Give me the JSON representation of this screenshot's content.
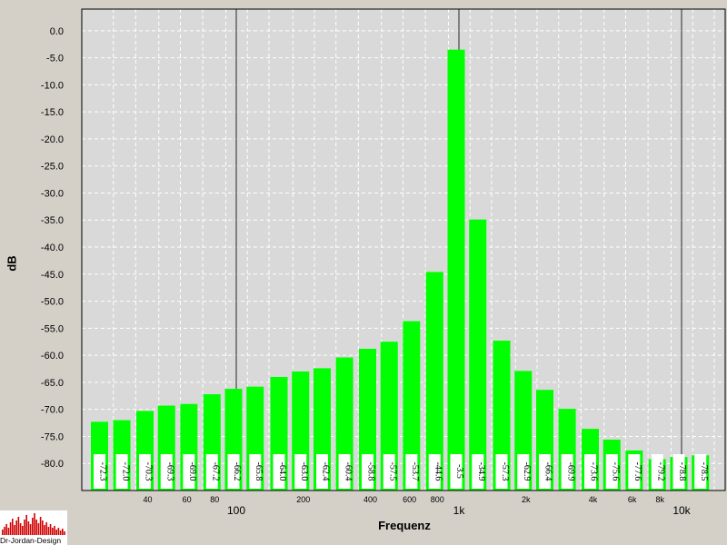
{
  "chart_data": {
    "type": "bar",
    "title": "",
    "xlabel": "Frequenz",
    "ylabel": "dB",
    "ylim": [
      -85,
      4
    ],
    "y_ticks": [
      0,
      -5,
      -10,
      -15,
      -20,
      -25,
      -30,
      -35,
      -40,
      -45,
      -50,
      -55,
      -60,
      -65,
      -70,
      -75,
      -80
    ],
    "x_scale": "log",
    "x_major_ticks": [
      {
        "value": 100,
        "label": "100"
      },
      {
        "value": 1000,
        "label": "1k"
      },
      {
        "value": 10000,
        "label": "10k"
      }
    ],
    "x_minor_ticks": [
      {
        "value": 40,
        "label": "40"
      },
      {
        "value": 60,
        "label": "60"
      },
      {
        "value": 80,
        "label": "80"
      },
      {
        "value": 200,
        "label": "200"
      },
      {
        "value": 400,
        "label": "400"
      },
      {
        "value": 600,
        "label": "600"
      },
      {
        "value": 800,
        "label": "800"
      },
      {
        "value": 2000,
        "label": "2k"
      },
      {
        "value": 4000,
        "label": "4k"
      },
      {
        "value": 6000,
        "label": "6k"
      },
      {
        "value": 8000,
        "label": "8k"
      }
    ],
    "x": [
      25,
      31.5,
      40,
      50,
      63,
      80,
      100,
      125,
      160,
      200,
      250,
      315,
      400,
      500,
      630,
      800,
      1000,
      1250,
      1600,
      2000,
      2500,
      3150,
      4000,
      5000,
      6300,
      8000,
      10000,
      12500
    ],
    "values": [
      -72.3,
      -72.0,
      -70.3,
      -69.3,
      -69.0,
      -67.2,
      -66.2,
      -65.8,
      -64.0,
      -63.0,
      -62.4,
      -60.4,
      -58.8,
      -57.5,
      -53.7,
      -44.6,
      -3.5,
      -34.9,
      -57.3,
      -62.9,
      -66.4,
      -69.9,
      -73.6,
      -75.6,
      -77.6,
      -79.2,
      -78.8,
      -78.5
    ],
    "labels": [
      "-72.3",
      "-72.0",
      "-70.3",
      "-69.3",
      "-69.0",
      "-67.2",
      "-66.2",
      "-65.8",
      "-64.0",
      "-63.0",
      "-62.4",
      "-60.4",
      "-58.8",
      "-57.5",
      "-53.7",
      "-44.6",
      "-3.5",
      "-34.9",
      "-57.3",
      "-62.9",
      "-66.4",
      "-69.9",
      "-73.6",
      "-75.6",
      "-77.6",
      "-79.2",
      "-78.8",
      "-78.5"
    ],
    "grid": true,
    "colors": {
      "bar": "#00ff00",
      "plot_background": "#d9d9d9",
      "background": "#d4d0c8",
      "grid": "#ffffff",
      "major_grid": "#808080"
    }
  },
  "logo": {
    "text": "Dr-Jordan-Design"
  }
}
